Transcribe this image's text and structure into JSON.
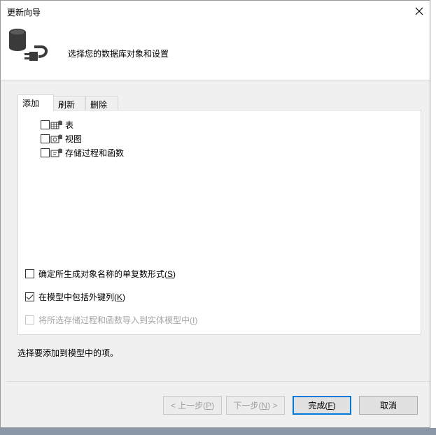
{
  "window": {
    "title": "更新向导",
    "close_icon": "close-icon"
  },
  "header": {
    "icon": "database-plug-icon",
    "text": "选择您的数据库对象和设置"
  },
  "tabs": [
    {
      "label": "添加",
      "active": true
    },
    {
      "label": "刷新",
      "active": false
    },
    {
      "label": "删除",
      "active": false
    }
  ],
  "tree": {
    "items": [
      {
        "label": "表",
        "checked": false,
        "icon": "table-icon"
      },
      {
        "label": "视图",
        "checked": false,
        "icon": "view-icon"
      },
      {
        "label": "存储过程和函数",
        "checked": false,
        "icon": "stored-procedure-icon"
      }
    ]
  },
  "options": {
    "pluralize": {
      "text": "确定所生成对象名称的单复数形式(",
      "key": "S",
      "tail": ")",
      "checked": false,
      "enabled": true
    },
    "foreign_keys": {
      "text": "在模型中包括外键列(",
      "key": "K",
      "tail": ")",
      "checked": true,
      "enabled": true
    },
    "import_procs": {
      "text": "将所选存储过程和函数导入到实体模型中(",
      "key": "I",
      "tail": ")",
      "checked": false,
      "enabled": false
    }
  },
  "status": "选择要添加到模型中的项。",
  "buttons": {
    "back": {
      "pre": "< 上一步(",
      "key": "P",
      "post": ")",
      "enabled": false
    },
    "next": {
      "pre": "下一步(",
      "key": "N",
      "post": ") >",
      "enabled": false
    },
    "finish": {
      "pre": "完成(",
      "key": "F",
      "post": ")",
      "enabled": true
    },
    "cancel": {
      "label": "取消",
      "enabled": true
    }
  },
  "colors": {
    "accent": "#0078d7",
    "window_bg": "#f0f0f0",
    "disabled_text": "#a6a6a6"
  }
}
